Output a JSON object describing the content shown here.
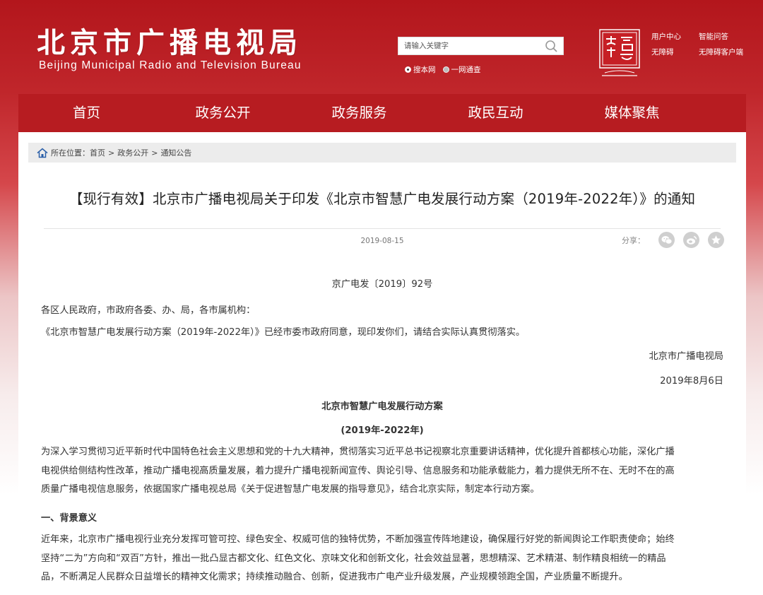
{
  "header": {
    "title_cn": "北京市广播电视局",
    "title_en": "Beijing Municipal Radio and Television Bureau",
    "search_placeholder": "请输入关键字",
    "scope_site": "搜本网",
    "scope_all": "一网通查",
    "links": {
      "user_center": "用户中心",
      "smart_qa": "智能问答",
      "accessible": "无障碍",
      "accessible_client": "无障碍客户端"
    }
  },
  "nav": [
    "首页",
    "政务公开",
    "政务服务",
    "政民互动",
    "媒体聚焦"
  ],
  "breadcrumb": {
    "prefix": "所在位置：",
    "items": [
      "首页",
      "政务公开",
      "通知公告"
    ]
  },
  "article": {
    "title": "【现行有效】北京市广播电视局关于印发《北京市智慧广电发展行动方案（2019年-2022年）》的通知",
    "date": "2019-08-15",
    "share_label": "分享：",
    "doc_number": "京广电发〔2019〕92号",
    "addressee": "各区人民政府，市政府各委、办、局，各市属机构：",
    "intro": "《北京市智慧广电发展行动方案（2019年-2022年）》已经市委市政府同意，现印发你们，请结合实际认真贯彻落实。",
    "signer": "北京市广播电视局",
    "sign_date": "2019年8月6日",
    "plan_title": "北京市智慧广电发展行动方案",
    "plan_years": "(2019年-2022年)",
    "para1": [
      "为深入学习贯彻习近平新时代中国特色社会主义思想和党的十九大精神，贯彻落实习近平总书记视察北京重要讲话精神，优化提升首都核心功能，深化广播",
      "电视供给侧结构性改革，推动广播电视高质量发展，着力提升广播电视新闻宣传、舆论引导、信息服务和功能承载能力，着力提供无所不在、无时不在的高",
      "质量广播电视信息服务，依据国家广播电视总局《关于促进智慧广电发展的指导意见》，结合北京实际，制定本行动方案。"
    ],
    "section1": "一、背景意义",
    "para2": [
      "近年来，北京市广播电视行业充分发挥可管可控、绿色安全、权威可信的独特优势，不断加强宣传阵地建设，确保履行好党的新闻舆论工作职责使命；始终",
      "坚持“二为”方向和“双百”方针，推出一批凸显古都文化、红色文化、京味文化和创新文化，社会效益显著，思想精深、艺术精湛、制作精良相统一的精品",
      "品，不断满足人民群众日益增长的精神文化需求；持续推动融合、创新，促进我市广电产业升级发展，产业规模领跑全国，产业质量不断提升。"
    ]
  },
  "colors": {
    "brand_red": "#b71c21",
    "header_red": "#b3161c"
  },
  "icons": [
    "search-icon",
    "home-icon",
    "wechat-icon",
    "weibo-icon",
    "star-icon",
    "beijing-china-logo"
  ]
}
